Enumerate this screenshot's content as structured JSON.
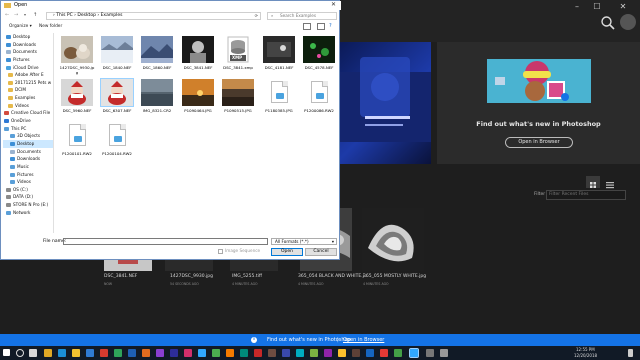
{
  "dialog": {
    "title": "Open",
    "address": {
      "path": "› This PC › Desktop › Examples",
      "search_placeholder": "Search Examples"
    },
    "commands": {
      "organize": "Organize ▾",
      "new_folder": "New folder"
    },
    "nav_items": [
      {
        "label": "Desktop",
        "color": "#3d8fd6"
      },
      {
        "label": "Downloads",
        "color": "#3d8fd6"
      },
      {
        "label": "Documents",
        "color": "#9ab3cf"
      },
      {
        "label": "Pictures",
        "color": "#3d8fd6"
      },
      {
        "label": "iCloud Drive",
        "color": "#4aa3df"
      },
      {
        "label": "Adobe After E",
        "color": "#e6b94a"
      },
      {
        "label": "20171215 Pets w",
        "color": "#e6b94a"
      },
      {
        "label": "DCIM",
        "color": "#e6b94a"
      },
      {
        "label": "Examples",
        "color": "#e6b94a"
      },
      {
        "label": "Videos",
        "color": "#e6b94a"
      },
      {
        "label": "Creative Cloud File",
        "color": "#d34b3d"
      },
      {
        "label": "OneDrive",
        "color": "#2f79d4"
      },
      {
        "label": "This PC",
        "color": "#5a9fd8"
      },
      {
        "label": "3D Objects",
        "color": "#5a9fd8"
      },
      {
        "label": "Desktop",
        "color": "#3d8fd6",
        "selected": true
      },
      {
        "label": "Documents",
        "color": "#9ab3cf"
      },
      {
        "label": "Downloads",
        "color": "#3d8fd6"
      },
      {
        "label": "Music",
        "color": "#5a9fd8"
      },
      {
        "label": "Pictures",
        "color": "#5a9fd8"
      },
      {
        "label": "Videos",
        "color": "#5a9fd8"
      },
      {
        "label": "OS (C:)",
        "color": "#8a8a8a"
      },
      {
        "label": "DATA (D:)",
        "color": "#8a8a8a"
      },
      {
        "label": "STORE N Pro (E:)",
        "color": "#8a8a8a"
      },
      {
        "label": "Network",
        "color": "#5a9fd8"
      },
      {
        "label": "",
        "color": "#ffffff"
      },
      {
        "label": "",
        "color": "#ffffff"
      }
    ],
    "files": [
      {
        "name": "1427DSC_9930.jpg",
        "kind": "photo-pets"
      },
      {
        "name": "DSC_1840.NEF",
        "kind": "photo-snow"
      },
      {
        "name": "DSC_1860.NEF",
        "kind": "photo-mountain"
      },
      {
        "name": "DSC_3841.NEF",
        "kind": "photo-portrait"
      },
      {
        "name": "DSC_3841.xmp",
        "kind": "xmp",
        "badge": "XMP"
      },
      {
        "name": "DSC_4181.NEF",
        "kind": "photo-dark"
      },
      {
        "name": "DSC_4578.NEF",
        "kind": "photo-green"
      },
      {
        "name": "DSC_5960.NEF",
        "kind": "photo-santa"
      },
      {
        "name": "DSC_6307.NEF",
        "kind": "photo-santa2",
        "selected": true
      },
      {
        "name": "IMG_8321.CR2",
        "kind": "photo-lake"
      },
      {
        "name": "P1090464.JPG",
        "kind": "photo-sunset"
      },
      {
        "name": "P1090515.JPG",
        "kind": "photo-sunset2"
      },
      {
        "name": "P1180385.JPG",
        "kind": "doc"
      },
      {
        "name": "P1200086.RW2",
        "kind": "doc"
      },
      {
        "name": "P1200101.RW2",
        "kind": "doc"
      },
      {
        "name": "P1200104.RW2",
        "kind": "doc"
      }
    ],
    "bottom": {
      "file_name_label": "File name:",
      "file_type": "All Formats (*.*)",
      "image_sequence": "Image Sequence",
      "open": "Open",
      "cancel": "Cancel"
    }
  },
  "photoshop": {
    "promo": {
      "title": "Find out what's new in Photoshop",
      "button": "Open in Browser"
    },
    "filter": {
      "label": "Filter",
      "placeholder": "Filter Recent Files"
    },
    "recent": [
      {
        "name": "DSC_3841.NEF",
        "time": "NOW"
      },
      {
        "name": "1427DSC_9930.jpg",
        "time": "54 SECONDS AGO"
      },
      {
        "name": "IMG_5255.tiff",
        "time": "4 MINUTES AGO"
      },
      {
        "name": "365_054 BLACK AND WHITE.j...",
        "time": "4 MINUTES AGO"
      },
      {
        "name": "365_055 MOSTLY WHITE.jpg",
        "time": "4 MINUTES AGO"
      }
    ]
  },
  "notification": {
    "text": "Find out what's new in Photoshop",
    "link": "Open in Browser"
  },
  "taskbar": {
    "time": "12:55 PM",
    "date": "12/20/2018"
  }
}
